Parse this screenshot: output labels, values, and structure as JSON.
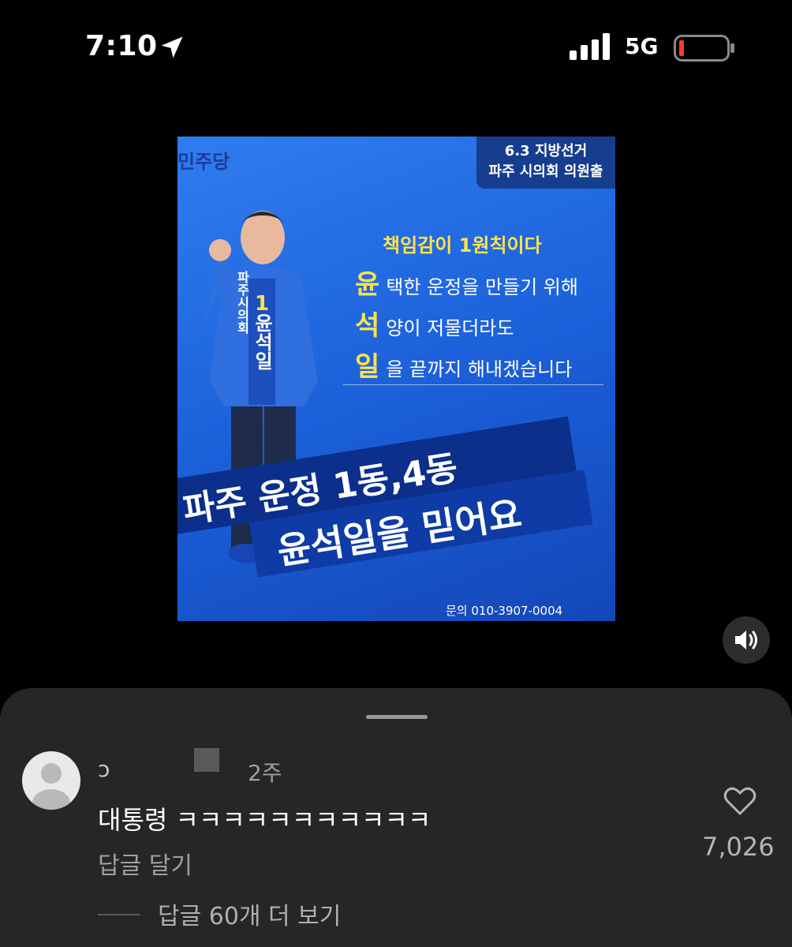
{
  "status_bar": {
    "time": "7:10",
    "network": "5G",
    "icons": [
      "location-arrow-icon",
      "signal-icon",
      "battery-low-icon"
    ]
  },
  "poster": {
    "party": "민주당",
    "tag_line1": "6.3 지방선거",
    "tag_line2": "파주 시의회 의원출",
    "slogan_title": "책임감이 1원칙이다",
    "lines": [
      {
        "big": "윤",
        "rest": "택한 운정을 만들기 위해"
      },
      {
        "big": "석",
        "rest": "양이 저물더라도"
      },
      {
        "big": "일",
        "rest": "을 끝까지 해내겠습니다"
      }
    ],
    "banner_line1": "파주 운정 1동,4동",
    "banner_line2": "윤석일을 믿어요",
    "contact": "문의 010-3907-0004",
    "sash_number": "1",
    "sash_name": "윤석일",
    "sash_org": "파주시의회"
  },
  "comment": {
    "username": "ɔ",
    "timestamp": "2주",
    "text": "대통령 ㅋㅋㅋㅋㅋㅋㅋㅋㅋㅋㅋ",
    "reply_label": "답글 달기",
    "view_more": "답글 60개 더 보기",
    "likes": "7,026"
  },
  "colors": {
    "accent_yellow": "#ffe34a",
    "poster_blue": "#1a5ed8",
    "sheet_bg": "#262626"
  }
}
